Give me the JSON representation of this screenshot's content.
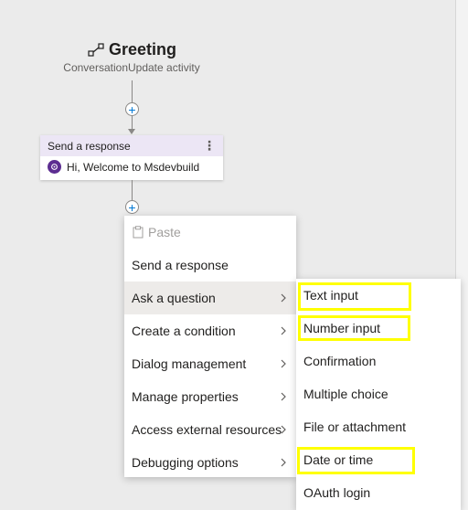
{
  "trigger": {
    "title": "Greeting",
    "subtitle": "ConversationUpdate activity",
    "icon": "trigger-icon"
  },
  "card": {
    "header": "Send a response",
    "more": "⋮",
    "message": "Hi, Welcome to Msdevbuild",
    "icon": "bot-icon"
  },
  "add_symbol": "+",
  "main_menu": {
    "paste": "Paste",
    "items": [
      "Send a response",
      "Ask a question",
      "Create a condition",
      "Dialog management",
      "Manage properties",
      "Access external resources",
      "Debugging options"
    ]
  },
  "sub_menu": {
    "items": [
      "Text input",
      "Number input",
      "Confirmation",
      "Multiple choice",
      "File or attachment",
      "Date or time",
      "OAuth login"
    ]
  },
  "colors": {
    "highlight": "#ffff00",
    "accent": "#0078d4",
    "card_header": "#ece6f5",
    "avatar": "#5c2d91"
  }
}
